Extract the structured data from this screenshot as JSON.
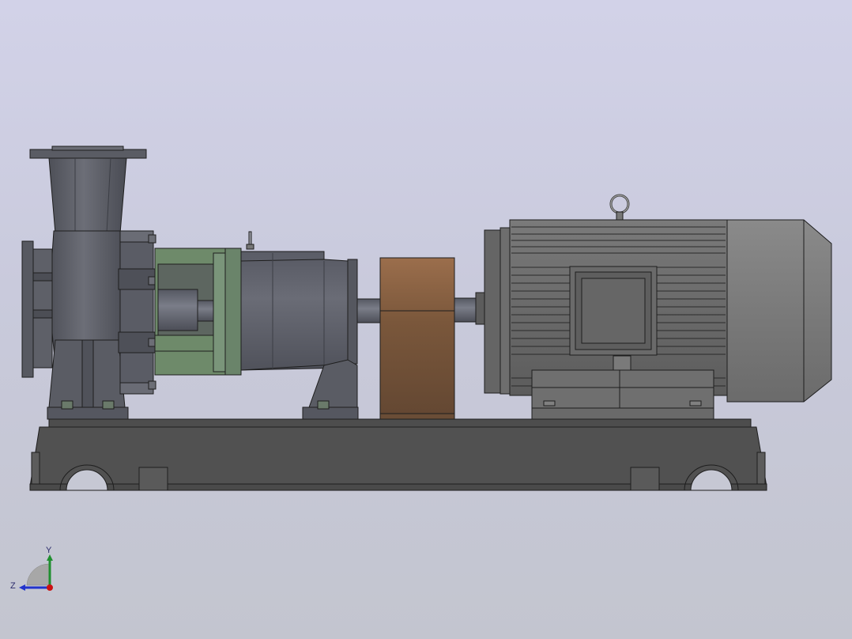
{
  "viewport": {
    "background_top": "#d2d2e8",
    "background_bottom": "#c3c5cf"
  },
  "model": {
    "parts": [
      "pump-casing",
      "suction-flange",
      "discharge-flange",
      "bearing-bracket",
      "bearing-frame",
      "coupling-guard",
      "electric-motor",
      "lifting-eye",
      "baseplate"
    ],
    "colors": {
      "pump_body": "#5e6068",
      "bracket": "#6e8a6a",
      "coupling_guard": "#8a5e3e",
      "motor": "#6a6a6a",
      "motor_fan_cover": "#7a7a7a",
      "baseplate": "#555555"
    }
  },
  "triad": {
    "y_label": "Y",
    "z_label": "Z",
    "y_color": "#1f8f2f",
    "z_color": "#2233cc",
    "x_color": "#cc1111"
  }
}
